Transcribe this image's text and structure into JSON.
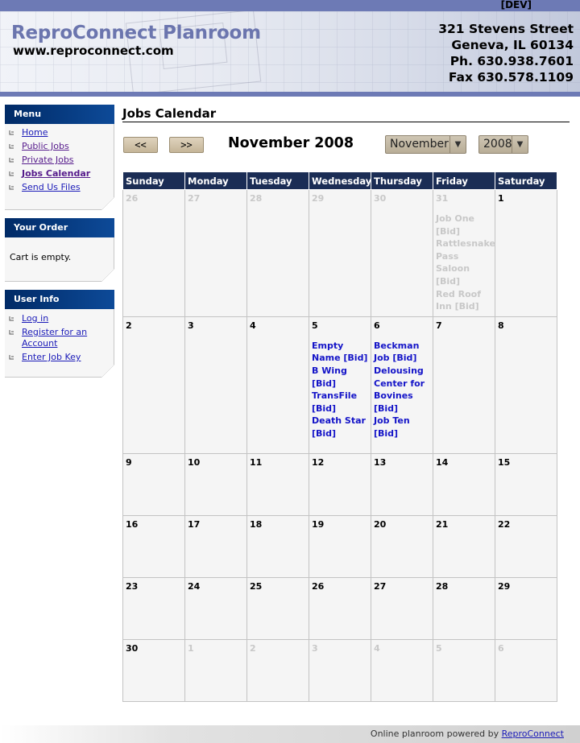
{
  "env_badge": "[DEV]",
  "header": {
    "brand": "ReproConnect Planroom",
    "website": "www.reproconnect.com",
    "address_lines": [
      "321 Stevens Street",
      "Geneva, IL 60134",
      "Ph. 630.938.7601",
      "Fax 630.578.1109"
    ]
  },
  "sidebar": {
    "menu": {
      "title": "Menu",
      "items": [
        {
          "label": "Home"
        },
        {
          "label": "Public Jobs"
        },
        {
          "label": "Private Jobs"
        },
        {
          "label": "Jobs Calendar"
        },
        {
          "label": "Send Us Files"
        }
      ]
    },
    "order": {
      "title": "Your Order",
      "cart_text": "Cart is empty."
    },
    "user": {
      "title": "User Info",
      "items": [
        {
          "label": "Log in"
        },
        {
          "label": "Register for an Account"
        },
        {
          "label": "Enter Job Key"
        }
      ]
    }
  },
  "main": {
    "title": "Jobs Calendar",
    "prev_label": "<<",
    "next_label": ">>",
    "month_heading": "November 2008",
    "month_select": "November",
    "year_select": "2008"
  },
  "calendar": {
    "day_names": [
      "Sunday",
      "Monday",
      "Tuesday",
      "Wednesday",
      "Thursday",
      "Friday",
      "Saturday"
    ],
    "weeks": [
      [
        {
          "day": "26",
          "other": true,
          "jobs": []
        },
        {
          "day": "27",
          "other": true,
          "jobs": []
        },
        {
          "day": "28",
          "other": true,
          "jobs": []
        },
        {
          "day": "29",
          "other": true,
          "jobs": []
        },
        {
          "day": "30",
          "other": true,
          "jobs": []
        },
        {
          "day": "31",
          "other": true,
          "jobs": [
            "Job One [Bid]",
            "Rattlesnake Pass Saloon [Bid]",
            "Red Roof Inn [Bid]"
          ]
        },
        {
          "day": "1",
          "other": false,
          "jobs": []
        }
      ],
      [
        {
          "day": "2",
          "other": false,
          "jobs": []
        },
        {
          "day": "3",
          "other": false,
          "jobs": []
        },
        {
          "day": "4",
          "other": false,
          "jobs": []
        },
        {
          "day": "5",
          "other": false,
          "jobs": [
            "Empty Name [Bid]",
            "B Wing [Bid]",
            "TransFile [Bid]",
            "Death Star [Bid]"
          ]
        },
        {
          "day": "6",
          "other": false,
          "jobs": [
            "Beckman Job [Bid]",
            "Delousing Center for Bovines [Bid]",
            "Job Ten [Bid]"
          ]
        },
        {
          "day": "7",
          "other": false,
          "jobs": []
        },
        {
          "day": "8",
          "other": false,
          "jobs": []
        }
      ],
      [
        {
          "day": "9",
          "other": false,
          "jobs": []
        },
        {
          "day": "10",
          "other": false,
          "jobs": []
        },
        {
          "day": "11",
          "other": false,
          "jobs": []
        },
        {
          "day": "12",
          "other": false,
          "jobs": []
        },
        {
          "day": "13",
          "other": false,
          "jobs": []
        },
        {
          "day": "14",
          "other": false,
          "jobs": []
        },
        {
          "day": "15",
          "other": false,
          "jobs": []
        }
      ],
      [
        {
          "day": "16",
          "other": false,
          "jobs": []
        },
        {
          "day": "17",
          "other": false,
          "jobs": []
        },
        {
          "day": "18",
          "other": false,
          "jobs": []
        },
        {
          "day": "19",
          "other": false,
          "jobs": []
        },
        {
          "day": "20",
          "other": false,
          "jobs": []
        },
        {
          "day": "21",
          "other": false,
          "jobs": []
        },
        {
          "day": "22",
          "other": false,
          "jobs": []
        }
      ],
      [
        {
          "day": "23",
          "other": false,
          "jobs": []
        },
        {
          "day": "24",
          "other": false,
          "jobs": []
        },
        {
          "day": "25",
          "other": false,
          "jobs": []
        },
        {
          "day": "26",
          "other": false,
          "jobs": []
        },
        {
          "day": "27",
          "other": false,
          "jobs": []
        },
        {
          "day": "28",
          "other": false,
          "jobs": []
        },
        {
          "day": "29",
          "other": false,
          "jobs": []
        }
      ],
      [
        {
          "day": "30",
          "other": false,
          "jobs": []
        },
        {
          "day": "1",
          "other": true,
          "jobs": []
        },
        {
          "day": "2",
          "other": true,
          "jobs": []
        },
        {
          "day": "3",
          "other": true,
          "jobs": []
        },
        {
          "day": "4",
          "other": true,
          "jobs": []
        },
        {
          "day": "5",
          "other": true,
          "jobs": []
        },
        {
          "day": "6",
          "other": true,
          "jobs": []
        }
      ]
    ]
  },
  "footer": {
    "text": "Online planroom powered by",
    "link": "ReproConnect"
  },
  "colors": {
    "nav_blue": "#1b2d55",
    "brand": "#6b75ae",
    "job_link": "#1414c8",
    "other_month": "#c8c8c8"
  }
}
